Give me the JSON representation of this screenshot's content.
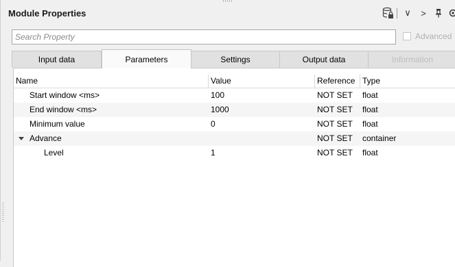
{
  "panel": {
    "title": "Module Properties"
  },
  "toolbar": {
    "icons": [
      "database-lock-icon",
      "chevron-down-icon",
      "chevron-right-icon",
      "pin-icon",
      "gear-icon"
    ],
    "chevron_down": "∨",
    "chevron_right": ">"
  },
  "search": {
    "placeholder": "Search Property",
    "value": ""
  },
  "advanced": {
    "label": "Advanced",
    "checked": false,
    "enabled": false
  },
  "tabs": [
    {
      "label": "Input data",
      "active": false,
      "enabled": true
    },
    {
      "label": "Parameters",
      "active": true,
      "enabled": true
    },
    {
      "label": "Settings",
      "active": false,
      "enabled": true
    },
    {
      "label": "Output data",
      "active": false,
      "enabled": true
    },
    {
      "label": "Information",
      "active": false,
      "enabled": false
    }
  ],
  "table": {
    "columns": [
      "Name",
      "Value",
      "Reference",
      "Type"
    ],
    "rows": [
      {
        "name": "Start window <ms>",
        "value": "100",
        "reference": "NOT SET",
        "type": "float",
        "level": 0
      },
      {
        "name": "End window <ms>",
        "value": "1000",
        "reference": "NOT SET",
        "type": "float",
        "level": 0
      },
      {
        "name": "Minimum value",
        "value": "0",
        "reference": "NOT SET",
        "type": "float",
        "level": 0
      },
      {
        "name": "Advance",
        "value": "",
        "reference": "NOT SET",
        "type": "container",
        "level": 0,
        "expanded": true
      },
      {
        "name": "Level",
        "value": "1",
        "reference": "NOT SET",
        "type": "float",
        "level": 1
      }
    ]
  }
}
